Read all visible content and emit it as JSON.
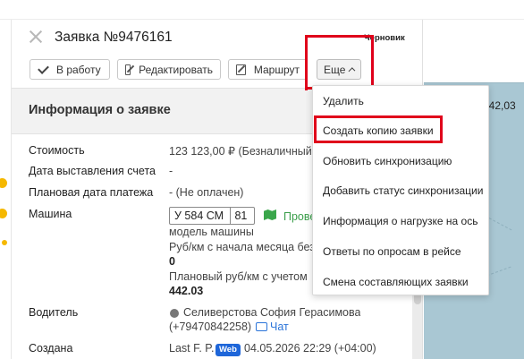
{
  "header": {
    "title": "Заявка №9476161",
    "status": "Черновик"
  },
  "toolbar": {
    "to_work_label": "В работу",
    "edit_label": "Редактировать",
    "route_label": "Маршрут",
    "more_label": "Еще"
  },
  "section": {
    "title": "Информация о заявке"
  },
  "fields": {
    "cost_label": "Стоимость",
    "cost_value": "123 123,00 ₽ (Безналичный,",
    "invoice_date_label": "Дата выставления счета",
    "invoice_date_value": "-",
    "planned_payment_label": "Плановая дата платежа",
    "planned_payment_value": "- (Не оплачен)",
    "vehicle_label": "Машина",
    "plate_number": "У 584 СМ",
    "plate_region": "81",
    "track_link": "Прове",
    "vehicle_model": "модель машины",
    "rub_km_month_label": "Руб/км с начала месяца без",
    "rub_km_month_value": "0",
    "planned_rub_km_label": "Плановый руб/км с учетом",
    "planned_rub_km_value": "442.03",
    "driver_label": "Водитель",
    "driver_name": "Селиверстова София Герасимова",
    "driver_phone": "(+79470842258)",
    "chat_label": "Чат",
    "created_label": "Создана",
    "created_by": "Last F. P.",
    "created_badge": "Web",
    "created_at": "04.05.2026 22:29 (+04:00)"
  },
  "map": {
    "value": "442,03"
  },
  "dropdown": {
    "items": [
      "Удалить",
      "Создать копию заявки",
      "Обновить синхронизацию",
      "Добавить статус синхронизации",
      "Информация о нагрузке на ось",
      "Ответы по опросам в рейсе",
      "Смена составляющих заявки"
    ]
  },
  "colors": {
    "highlight": "#e0001b",
    "accent_blue": "#1e66d9",
    "accent_green": "#3a9e4a",
    "warning_dot": "#f5b800"
  }
}
